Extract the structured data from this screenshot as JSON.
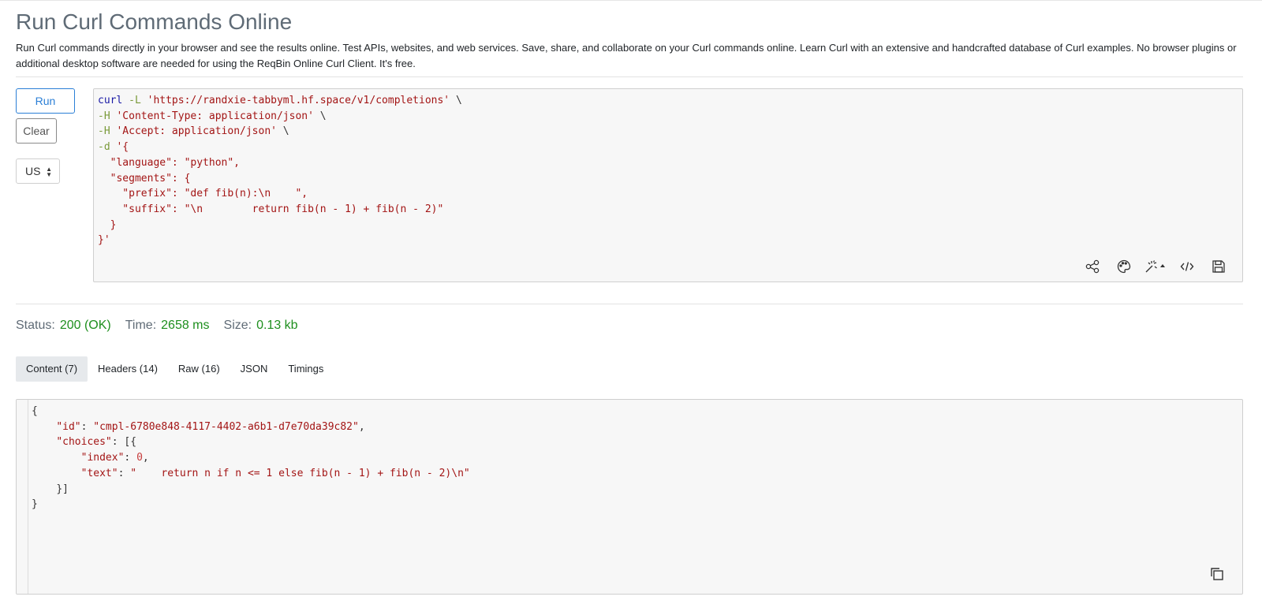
{
  "page": {
    "title": "Run Curl Commands Online",
    "description": "Run Curl commands directly in your browser and see the results online. Test APIs, websites, and web services. Save, share, and collaborate on your Curl commands online. Learn Curl with an extensive and handcrafted database of Curl examples. No browser plugins or additional desktop software are needed for using the ReqBin Online Curl Client. It's free."
  },
  "controls": {
    "run_label": "Run",
    "clear_label": "Clear",
    "region_value": "US"
  },
  "editor": {
    "line1": {
      "cmd": "curl",
      "flag": "-L",
      "url": "'https://randxie-tabbyml.hf.space/v1/completions'",
      "cont": " \\"
    },
    "line2": {
      "flag": "-H",
      "val": "'Content-Type: application/json'",
      "cont": " \\"
    },
    "line3": {
      "flag": "-H",
      "val": "'Accept: application/json'",
      "cont": " \\"
    },
    "line4": {
      "flag": "-d",
      "val": "'{"
    },
    "line5": "  \"language\": \"python\",",
    "line6": "  \"segments\": {",
    "line7": "    \"prefix\": \"def fib(n):\\n    \",",
    "line8": "    \"suffix\": \"\\n        return fib(n - 1) + fib(n - 2)\"",
    "line9": "  }",
    "line10": "}'",
    "toolbar_icons": [
      "share-icon",
      "palette-icon",
      "magic-wand-icon",
      "code-icon",
      "save-icon"
    ]
  },
  "status": {
    "status_label": "Status:",
    "status_value": "200 (OK)",
    "time_label": "Time:",
    "time_value": "2658 ms",
    "size_label": "Size:",
    "size_value": "0.13 kb",
    "value_color": "#1e8f1e"
  },
  "tabs": [
    {
      "label": "Content (7)",
      "active": true
    },
    {
      "label": "Headers (14)",
      "active": false
    },
    {
      "label": "Raw (16)",
      "active": false
    },
    {
      "label": "JSON",
      "active": false
    },
    {
      "label": "Timings",
      "active": false
    }
  ],
  "response": {
    "open": "{",
    "id_key": "\"id\"",
    "id_val": "\"cmpl-6780e848-4117-4402-a6b1-d7e70da39c82\"",
    "choices_key": "\"choices\"",
    "choices_open": "[{",
    "index_key": "\"index\"",
    "index_val": "0",
    "text_key": "\"text\"",
    "text_val": "\"    return n if n <= 1 else fib(n - 1) + fib(n - 2)\\n\"",
    "choices_close": "}]",
    "close": "}"
  }
}
